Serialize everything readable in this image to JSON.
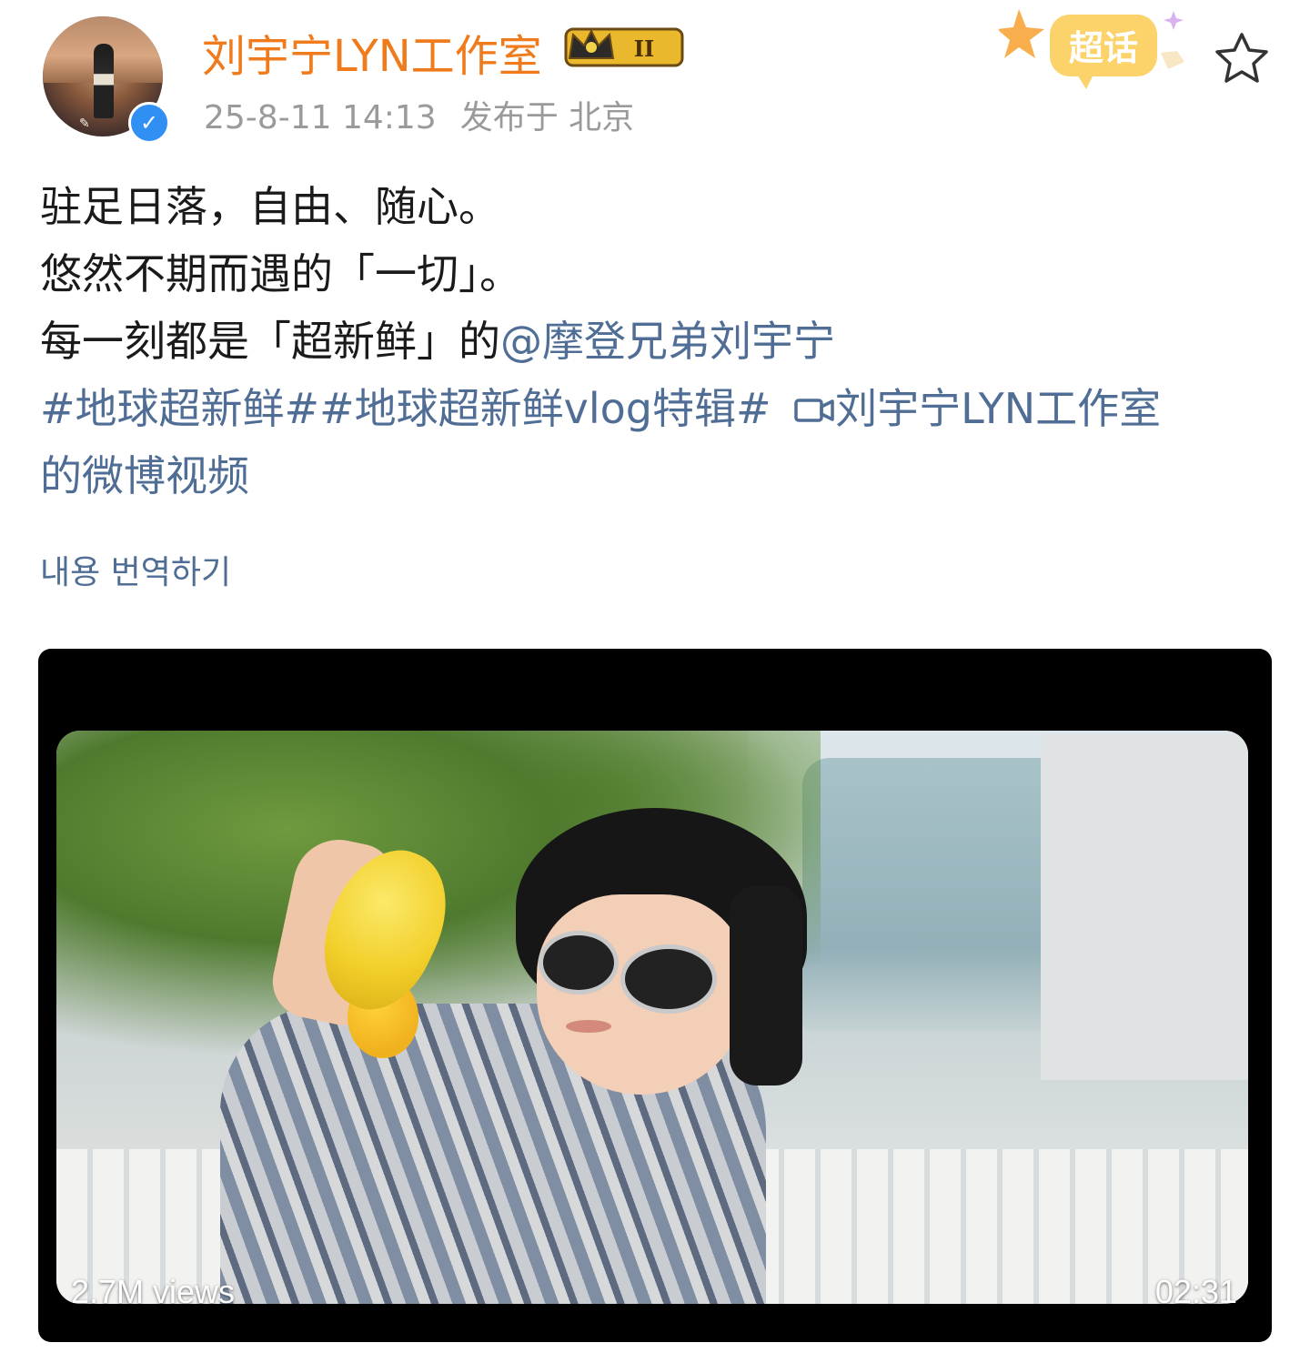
{
  "post": {
    "username": "刘宇宁LYN工作室",
    "level_badge": "II",
    "date": "25-8-11 14:13",
    "location": "发布于 北京",
    "supertopic_label": "超话",
    "content": {
      "line1": "驻足日落，自由、随心。",
      "line2": "悠然不期而遇的「一切」。",
      "line3_text": "每一刻都是「超新鲜」的",
      "line3_mention": "@摩登兄弟刘宇宁",
      "hashtag1": "#地球超新鲜#",
      "hashtag2": "#地球超新鲜vlog特辑#",
      "video_link": "刘宇宁LYN工作室的微博视频"
    },
    "translate_label": "내용 번역하기",
    "video": {
      "views": "2.7M views",
      "duration": "02:31"
    }
  },
  "colors": {
    "username": "#f07b1d",
    "link": "#4f6d95",
    "meta": "#9a9a9a",
    "verified": "#2f8ff2"
  },
  "icons": {
    "verified": "verified-check-icon",
    "level": "crown-level-badge-icon",
    "supertopic": "supertopic-badge-icon",
    "favorite": "star-outline-icon",
    "video": "video-camera-icon"
  }
}
